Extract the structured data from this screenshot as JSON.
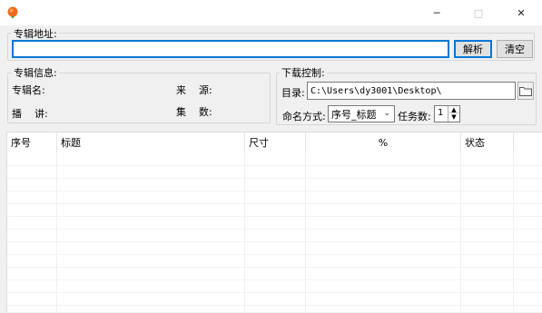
{
  "window": {
    "app_icon": "orange-balloon-icon",
    "controls": {
      "minimize": "─",
      "maximize": "□",
      "close": "✕"
    }
  },
  "album_address": {
    "legend": "专辑地址:",
    "url_value": "",
    "parse_button": "解析",
    "clear_button": "清空"
  },
  "album_info": {
    "legend": "专辑信息:",
    "name_label": "专辑名:",
    "source_label": "来    源:",
    "narrator_label": "播    讲:",
    "episodes_label": "集    数:"
  },
  "download_control": {
    "legend": "下载控制:",
    "dir_label": "目录:",
    "dir_value": "C:\\Users\\dy3001\\Desktop\\",
    "browse_icon": "folder-icon",
    "naming_label": "命名方式:",
    "naming_selected": "序号_标题",
    "tasks_label": "任务数:",
    "tasks_value": "1"
  },
  "table": {
    "columns": [
      "序号",
      "标题",
      "尺寸",
      "%",
      "状态"
    ],
    "rows": []
  },
  "colors": {
    "accent": "#0078d7",
    "window_bg": "#f0f0f0",
    "titlebar_bg": "#ffffff"
  }
}
